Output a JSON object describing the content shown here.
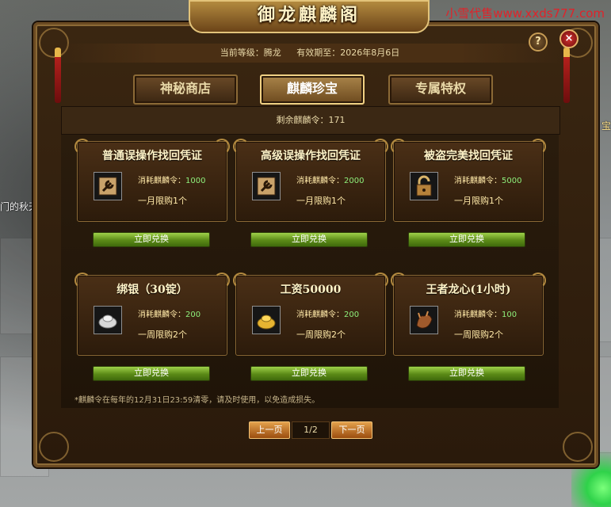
{
  "watermark": "小雪代售www.xxds777.com",
  "scene": {
    "left_player_name": "门的秋天",
    "right_fragment": "宝"
  },
  "window": {
    "title": "御龙麒麟阁",
    "help_label": "?",
    "close_label": "×",
    "info": {
      "level": "当前等级：腾龙",
      "expiry": "有效期至：2026年8月6日"
    },
    "tabs": [
      {
        "label": "神秘商店",
        "active": false
      },
      {
        "label": "麒麟珍宝",
        "active": true
      },
      {
        "label": "专属特权",
        "active": false
      }
    ],
    "balance": "剩余麒麟令：171",
    "items": [
      {
        "title": "普通误操作找回凭证",
        "cost_label": "消耗麒麟令：",
        "cost": "1000",
        "limit": "一月限购1个",
        "icon": "wrench-scroll-icon",
        "buy_label": "立即兑换"
      },
      {
        "title": "高级误操作找回凭证",
        "cost_label": "消耗麒麟令：",
        "cost": "2000",
        "limit": "一月限购1个",
        "icon": "wrench-scroll-icon",
        "buy_label": "立即兑换"
      },
      {
        "title": "被盗完美找回凭证",
        "cost_label": "消耗麒麟令：",
        "cost": "5000",
        "limit": "一月限购1个",
        "icon": "padlock-icon",
        "buy_label": "立即兑换"
      },
      {
        "title": "绑银（30锭）",
        "cost_label": "消耗麒麟令：",
        "cost": "200",
        "limit": "一周限购2个",
        "icon": "silver-ingot-icon",
        "buy_label": "立即兑换"
      },
      {
        "title": "工资50000",
        "cost_label": "消耗麒麟令：",
        "cost": "200",
        "limit": "一周限购2个",
        "icon": "gold-ingot-icon",
        "buy_label": "立即兑换"
      },
      {
        "title": "王者龙心(1小时)",
        "cost_label": "消耗麒麟令：",
        "cost": "100",
        "limit": "一周限购2个",
        "icon": "dragon-heart-icon",
        "buy_label": "立即兑换"
      }
    ],
    "notice": "*麒麟令在每年的12月31日23:59清零，请及时使用，以免造成损失。",
    "pager": {
      "prev_label": "上一页",
      "page": "1/2",
      "next_label": "下一页"
    }
  },
  "colors": {
    "accent_gold": "#e9d9a8",
    "cost_green": "#8ef07c",
    "button_green": "#5b8a17",
    "pager_orange": "#c06a1c"
  }
}
